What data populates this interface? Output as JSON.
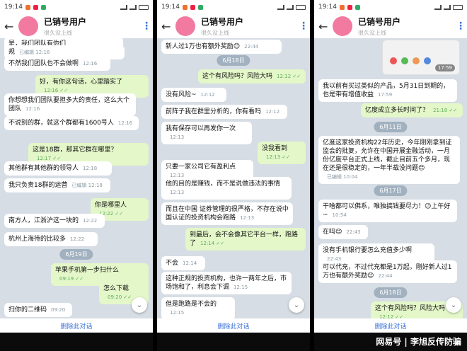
{
  "status": {
    "time": "19:14"
  },
  "header": {
    "title": "已销号用户",
    "subtitle": "很久没上线"
  },
  "footer": {
    "delete_label": "删除此对话"
  },
  "watermark": "网易号 | 李旭反传防骗",
  "panels": [
    {
      "messages": [
        {
          "dir": "in",
          "text": "是，我们团队有你们",
          "meta": "",
          "top": 0
        },
        {
          "dir": "in",
          "text": "规",
          "meta": "已编辑 12:16",
          "top": 0
        },
        {
          "dir": "in",
          "text": "不然我们团队也不会做啊",
          "meta": "12:16",
          "top": 0
        },
        {
          "dir": "out",
          "text": "好，有你这句话，心里踏实了",
          "meta": "12:16",
          "top": 0
        },
        {
          "dir": "in",
          "text": "你想想我们团队要担多大的责任，这么大个团队",
          "meta": "12:16",
          "top": 0
        },
        {
          "dir": "in",
          "text": "不说别的群，就这个群都有1600号人",
          "meta": "12:16",
          "top": 0
        },
        {
          "dir": "out",
          "text": "这是18群，那其它群在哪里？",
          "meta": "12:17",
          "top": 0
        },
        {
          "dir": "in",
          "text": "其他群有其他群的领导人",
          "meta": "12:18",
          "top": 0
        },
        {
          "dir": "in",
          "text": "我只负责18群的运营",
          "meta": "已编辑 12:18",
          "top": 0
        },
        {
          "dir": "out",
          "text": "你是哪里人",
          "meta": "12:22",
          "top": 0
        },
        {
          "dir": "in",
          "text": "南方人，江浙沪这一块的",
          "meta": "12:22",
          "top": 0
        },
        {
          "dir": "in",
          "text": "杭州上海待的比较多",
          "meta": "12:22",
          "top": 0
        },
        {
          "dir": "date",
          "text": "6月19日"
        },
        {
          "dir": "out",
          "text": "苹果手机第一步扫什么",
          "meta": "09:19",
          "top": 0
        },
        {
          "dir": "out",
          "text": "怎么下载",
          "meta": "09:20",
          "top": 0
        },
        {
          "dir": "in",
          "text": "扫你的二维码",
          "meta": "09:20",
          "top": 0
        }
      ]
    },
    {
      "messages": [
        {
          "dir": "in",
          "text": "新人过1万也有额外奖励😊",
          "meta": "22:44"
        },
        {
          "dir": "date",
          "text": "6月18日"
        },
        {
          "dir": "out",
          "text": "这个有风险吗？风险大吗",
          "meta": "12:12"
        },
        {
          "dir": "in",
          "text": "没有风险~",
          "meta": "12:12"
        },
        {
          "dir": "in",
          "text": "前阵子我在群里分析的，你有看吗",
          "meta": "12:12"
        },
        {
          "dir": "in",
          "text": "我有保存可以再发你一次",
          "meta": "12:13"
        },
        {
          "dir": "out",
          "text": "没我看到",
          "meta": "12:13"
        },
        {
          "dir": "in",
          "text": "只要一家公司它有盈利点",
          "meta": "12:13"
        },
        {
          "dir": "in",
          "text": "他的目的是赚钱，而不是说做违法的事情",
          "meta": "12:13"
        },
        {
          "dir": "in",
          "text": "而且在中国 证券管理的很严格，不存在说中国认证的投资机构会跑路",
          "meta": "12:13"
        },
        {
          "dir": "out",
          "text": "到最后，会不会像其它平台一样，跑路了",
          "meta": "12:14"
        },
        {
          "dir": "in",
          "text": "不会",
          "meta": "12:14"
        },
        {
          "dir": "in",
          "text": "这种正规的投资机构，也许一两年之后，市场饱和了，利息会下调",
          "meta": "12:15"
        },
        {
          "dir": "in",
          "text": "但是跑路是不会的",
          "meta": "12:15"
        }
      ]
    },
    {
      "messages": [
        {
          "dir": "img",
          "text": "",
          "meta": "17:59"
        },
        {
          "dir": "in",
          "text": "我以前有买过类似的产品，5月31日到期的，也是带有增值收益",
          "meta": "17:59"
        },
        {
          "dir": "out",
          "text": "亿度成立多长时间了？",
          "meta": "21:18"
        },
        {
          "dir": "date",
          "text": "6月11日"
        },
        {
          "dir": "in",
          "text": "亿度这家投资机构22年历史，今年刚刚拿到证监会的批复，允许在中国开展金融活动，一月份亿度平台正式上线，截止目前五个多月，现在还是很稳定的，一年半载没问题😊",
          "meta": "已编辑 10:04"
        },
        {
          "dir": "date",
          "text": "6月17日"
        },
        {
          "dir": "in",
          "text": "干啥都可以佛系，唯独搞钱要尽力！😉上午好~",
          "meta": "10:54"
        },
        {
          "dir": "in",
          "text": "在吗😊",
          "meta": "22:43"
        },
        {
          "dir": "in",
          "text": "没有手机银行要怎么充值多少啊",
          "meta": "22:43"
        },
        {
          "dir": "in",
          "text": "可以代充，不过代充都是1万起，刚好新人过1万也有额外奖励😊",
          "meta": "22:44"
        },
        {
          "dir": "date",
          "text": "6月18日"
        },
        {
          "dir": "out",
          "text": "这个有风险吗？风险大吗",
          "meta": "12:12"
        }
      ]
    }
  ]
}
